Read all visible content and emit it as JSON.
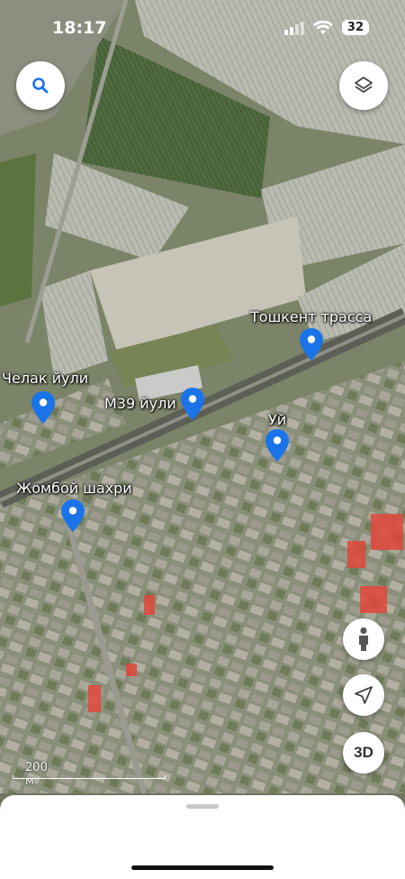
{
  "status": {
    "time": "18:17",
    "battery": "32"
  },
  "map": {
    "places": [
      {
        "name": "Тошкент трасса"
      },
      {
        "name": "Челак йули"
      },
      {
        "name": "M39 йули"
      },
      {
        "name": "Уй"
      },
      {
        "name": "Жомбой шахри"
      }
    ],
    "scale": "200 м"
  },
  "controls": {
    "search_icon": "search-icon",
    "layers_icon": "layers-icon",
    "pegman_icon": "person-icon",
    "locate_icon": "navigation-arrow-icon",
    "mode_3d": "3D"
  },
  "colors": {
    "pin": "#1a73e8",
    "accent_red": "#e1473a"
  }
}
